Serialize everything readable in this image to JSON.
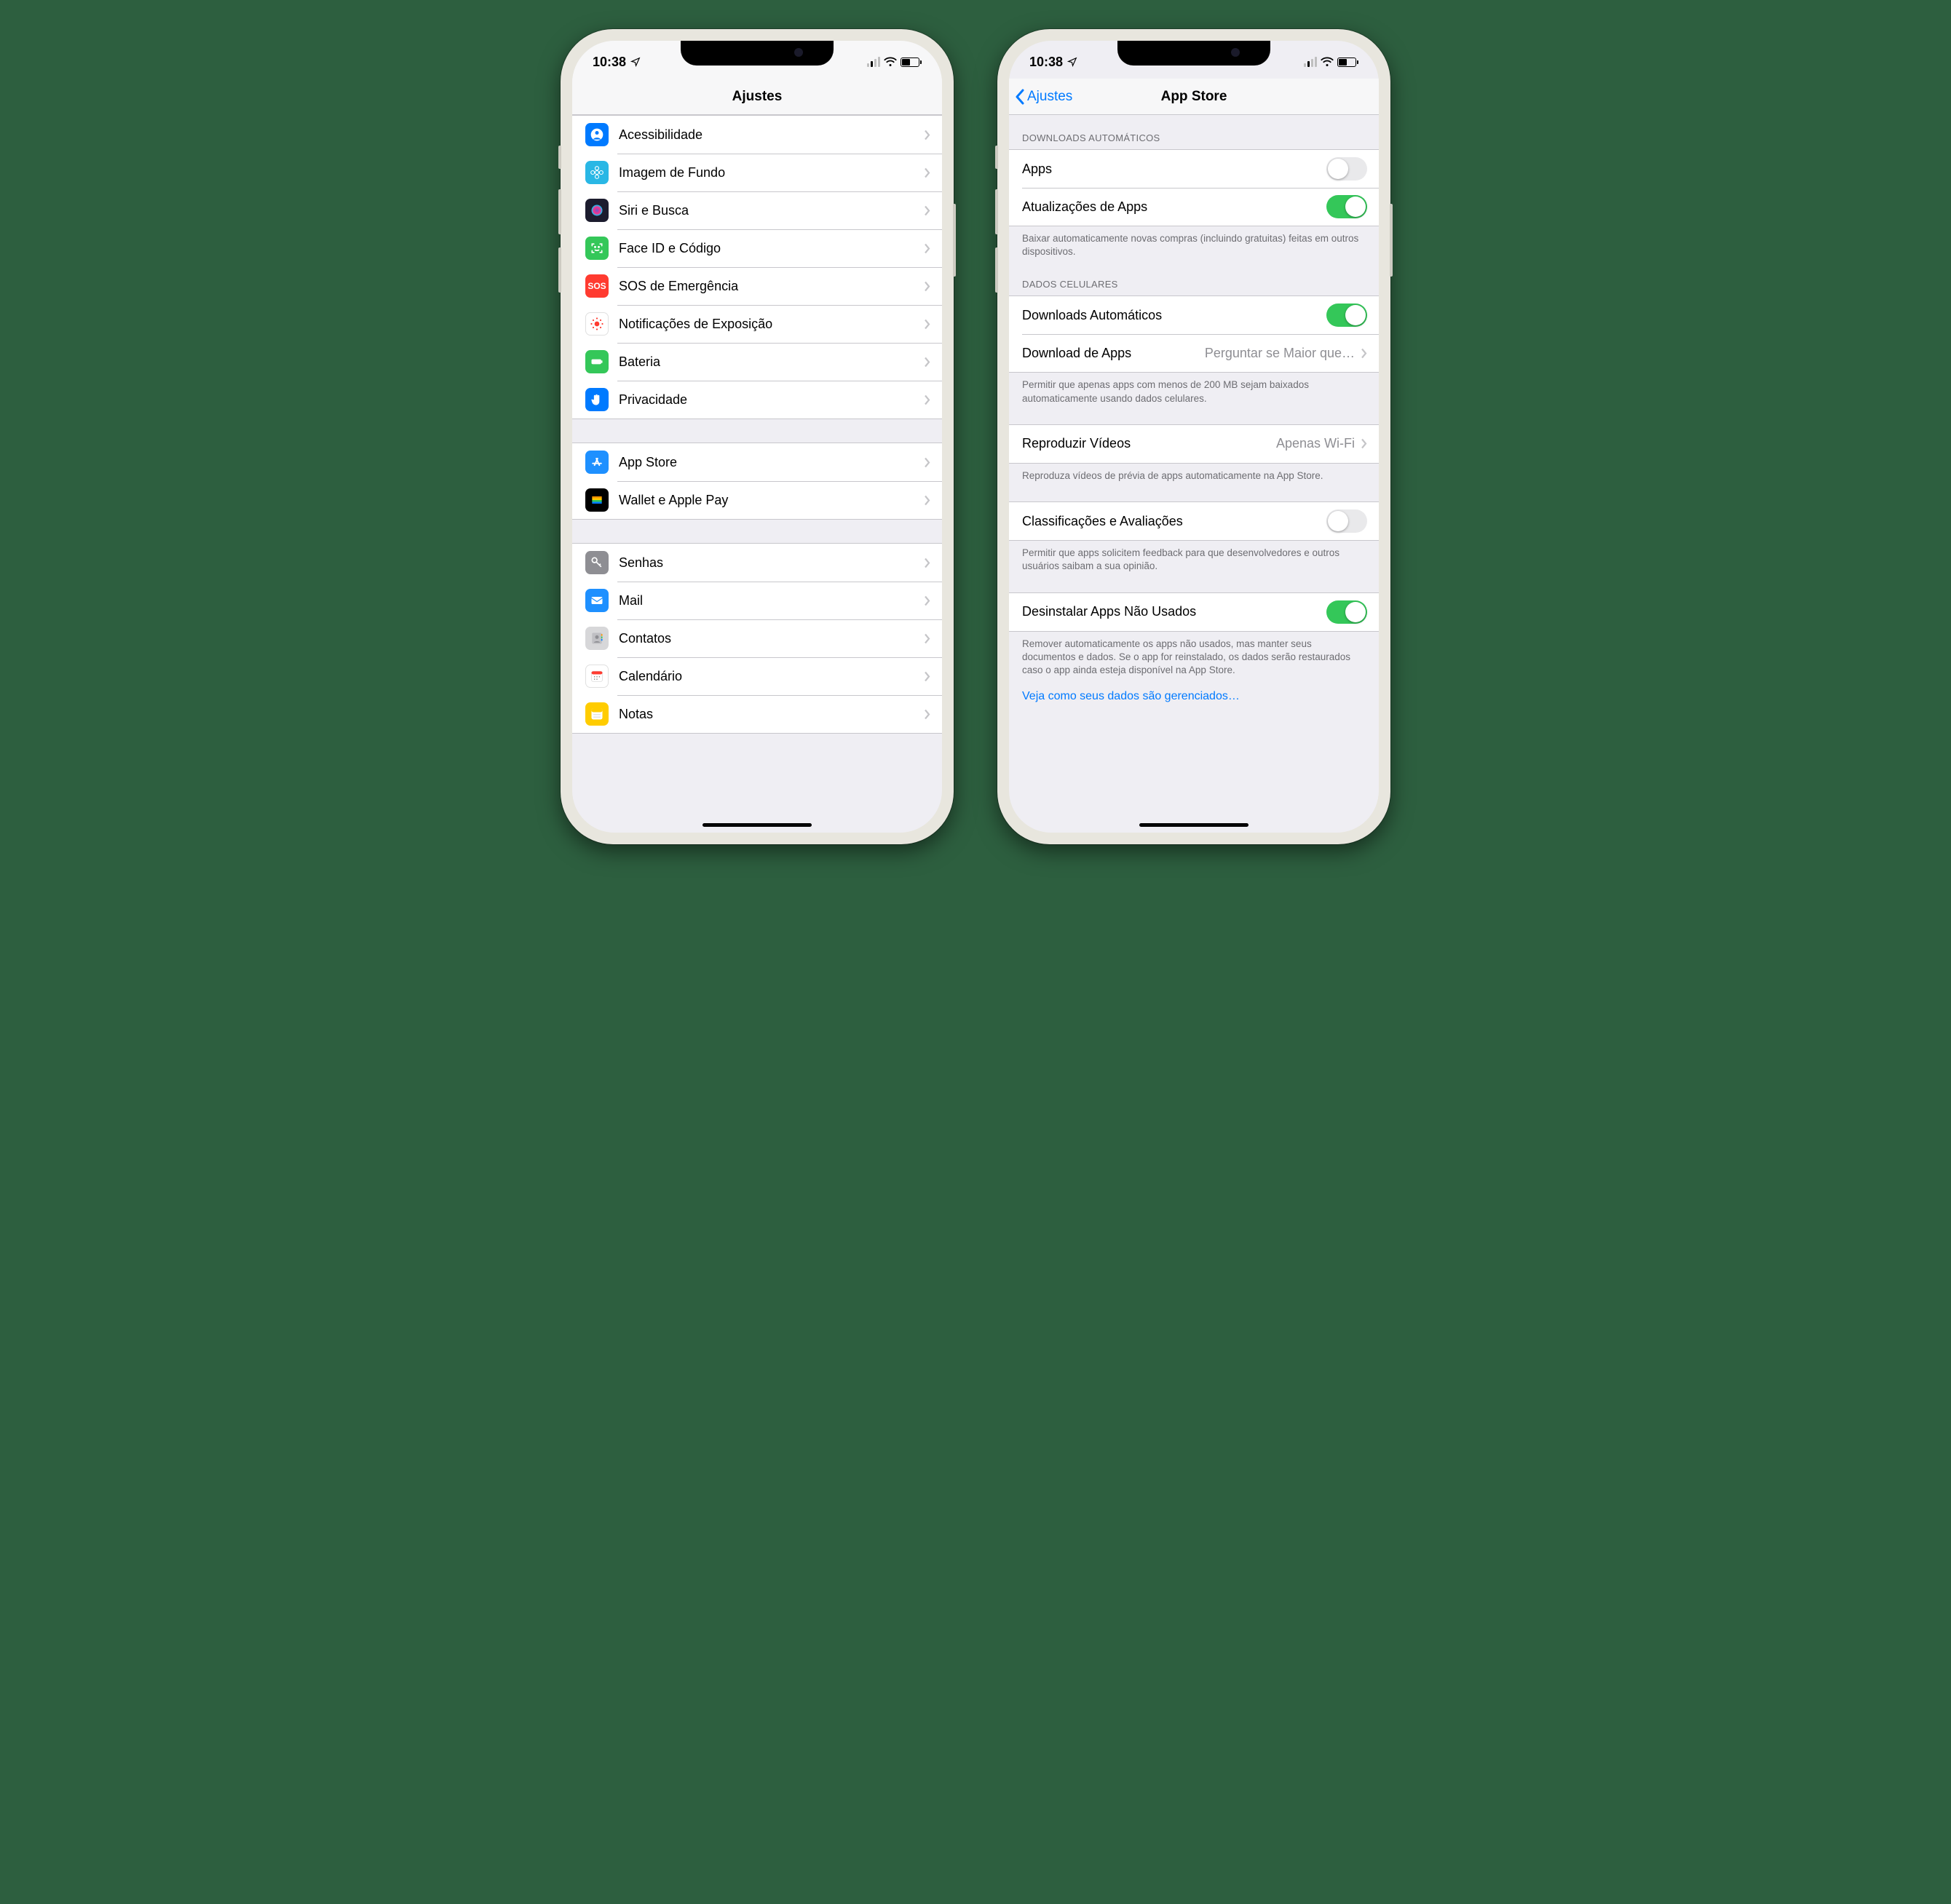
{
  "status": {
    "time": "10:38"
  },
  "left_phone": {
    "header": {
      "title": "Ajustes"
    },
    "groups": [
      {
        "items": [
          {
            "label": "Acessibilidade",
            "iconName": "accessibility-icon",
            "iconBg": "#007aff",
            "glyph": "person"
          },
          {
            "label": "Imagem de Fundo",
            "iconName": "wallpaper-icon",
            "iconBg": "#29b7e5",
            "glyph": "flower"
          },
          {
            "label": "Siri e Busca",
            "iconName": "siri-icon",
            "iconBg": "#1c1c2e",
            "glyph": "siri"
          },
          {
            "label": "Face ID e Código",
            "iconName": "faceid-icon",
            "iconBg": "#34c759",
            "glyph": "faceid"
          },
          {
            "label": "SOS de Emergência",
            "iconName": "sos-icon",
            "iconBg": "#ff3b30",
            "glyph": "text-SOS"
          },
          {
            "label": "Notificações de Exposição",
            "iconName": "exposure-icon",
            "iconBg": "#ffffff",
            "glyph": "exposure"
          },
          {
            "label": "Bateria",
            "iconName": "battery-icon",
            "iconBg": "#34c759",
            "glyph": "battery"
          },
          {
            "label": "Privacidade",
            "iconName": "privacy-icon",
            "iconBg": "#007aff",
            "glyph": "hand"
          }
        ]
      },
      {
        "items": [
          {
            "label": "App Store",
            "iconName": "appstore-icon",
            "iconBg": "#1e90ff",
            "glyph": "appstore"
          },
          {
            "label": "Wallet e Apple Pay",
            "iconName": "wallet-icon",
            "iconBg": "#000000",
            "glyph": "wallet"
          }
        ]
      },
      {
        "items": [
          {
            "label": "Senhas",
            "iconName": "passwords-icon",
            "iconBg": "#8e8e93",
            "glyph": "key"
          },
          {
            "label": "Mail",
            "iconName": "mail-icon",
            "iconBg": "#1e90ff",
            "glyph": "mail"
          },
          {
            "label": "Contatos",
            "iconName": "contacts-icon",
            "iconBg": "#d7d7d9",
            "glyph": "contacts"
          },
          {
            "label": "Calendário",
            "iconName": "calendar-icon",
            "iconBg": "#ffffff",
            "glyph": "calendar"
          },
          {
            "label": "Notas",
            "iconName": "notes-icon",
            "iconBg": "#ffcc00",
            "glyph": "notes"
          }
        ]
      }
    ]
  },
  "right_phone": {
    "header": {
      "title": "App Store",
      "back": "Ajustes"
    },
    "sections": [
      {
        "header": "DOWNLOADS AUTOMÁTICOS",
        "items": [
          {
            "kind": "toggle",
            "label": "Apps",
            "on": false
          },
          {
            "kind": "toggle",
            "label": "Atualizações de Apps",
            "on": true
          }
        ],
        "footer": "Baixar automaticamente novas compras (incluindo gratuitas) feitas em outros dispositivos."
      },
      {
        "header": "DADOS CELULARES",
        "items": [
          {
            "kind": "toggle",
            "label": "Downloads Automáticos",
            "on": true
          },
          {
            "kind": "nav",
            "label": "Download de Apps",
            "value": "Perguntar se Maior que…"
          }
        ],
        "footer": "Permitir que apenas apps com menos de 200 MB sejam baixados automaticamente usando dados celulares."
      },
      {
        "items": [
          {
            "kind": "nav",
            "label": "Reproduzir Vídeos",
            "value": "Apenas Wi-Fi"
          }
        ],
        "footer": "Reproduza vídeos de prévia de apps automaticamente na App Store."
      },
      {
        "items": [
          {
            "kind": "toggle",
            "label": "Classificações e Avaliações",
            "on": false
          }
        ],
        "footer": "Permitir que apps solicitem feedback para que desenvolvedores e outros usuários saibam a sua opinião."
      },
      {
        "items": [
          {
            "kind": "toggle",
            "label": "Desinstalar Apps Não Usados",
            "on": true
          }
        ],
        "footer": "Remover automaticamente os apps não usados, mas manter seus documentos e dados. Se o app for reinstalado, os dados serão restaurados caso o app ainda esteja disponível na App Store."
      }
    ],
    "bottom_link": "Veja como seus dados são gerenciados…"
  }
}
